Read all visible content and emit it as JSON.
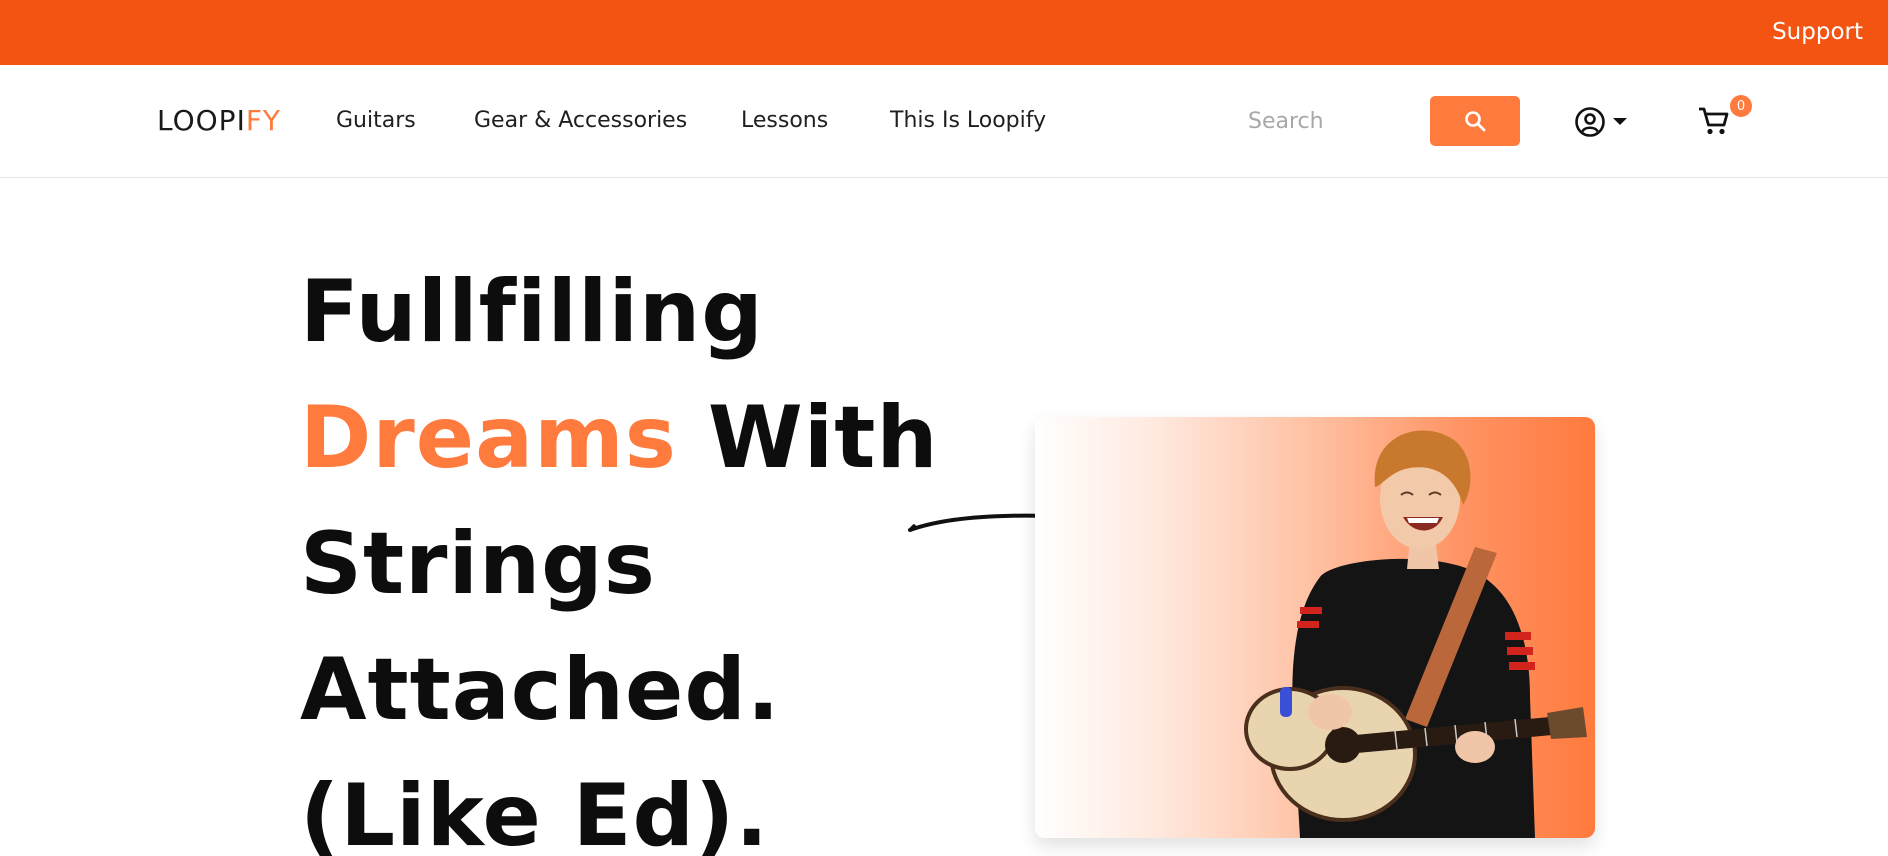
{
  "topbar": {
    "support_label": "Support",
    "color": "#f35412"
  },
  "brand": {
    "logo_part1": "LOOPI",
    "logo_part2": "FY",
    "accent_color": "#ff7a3d"
  },
  "nav": {
    "items": [
      {
        "label": "Guitars"
      },
      {
        "label": "Gear & Accessories"
      },
      {
        "label": "Lessons"
      },
      {
        "label": "This Is Loopify"
      }
    ]
  },
  "search": {
    "placeholder": "Search",
    "value": "",
    "icon": "search-icon"
  },
  "account": {
    "icon": "user-circle-icon",
    "dropdown_icon": "caret-down-icon"
  },
  "cart": {
    "icon": "cart-icon",
    "count": "0"
  },
  "hero": {
    "line1": "Fullfilling",
    "line2_accent": "Dreams",
    "line2_rest": " With",
    "line3": "Strings",
    "line4": "Attached.",
    "line5": "(Like Ed).",
    "arrow_icon": "hand-drawn-arrow-icon",
    "image": "guitarist-photo"
  }
}
